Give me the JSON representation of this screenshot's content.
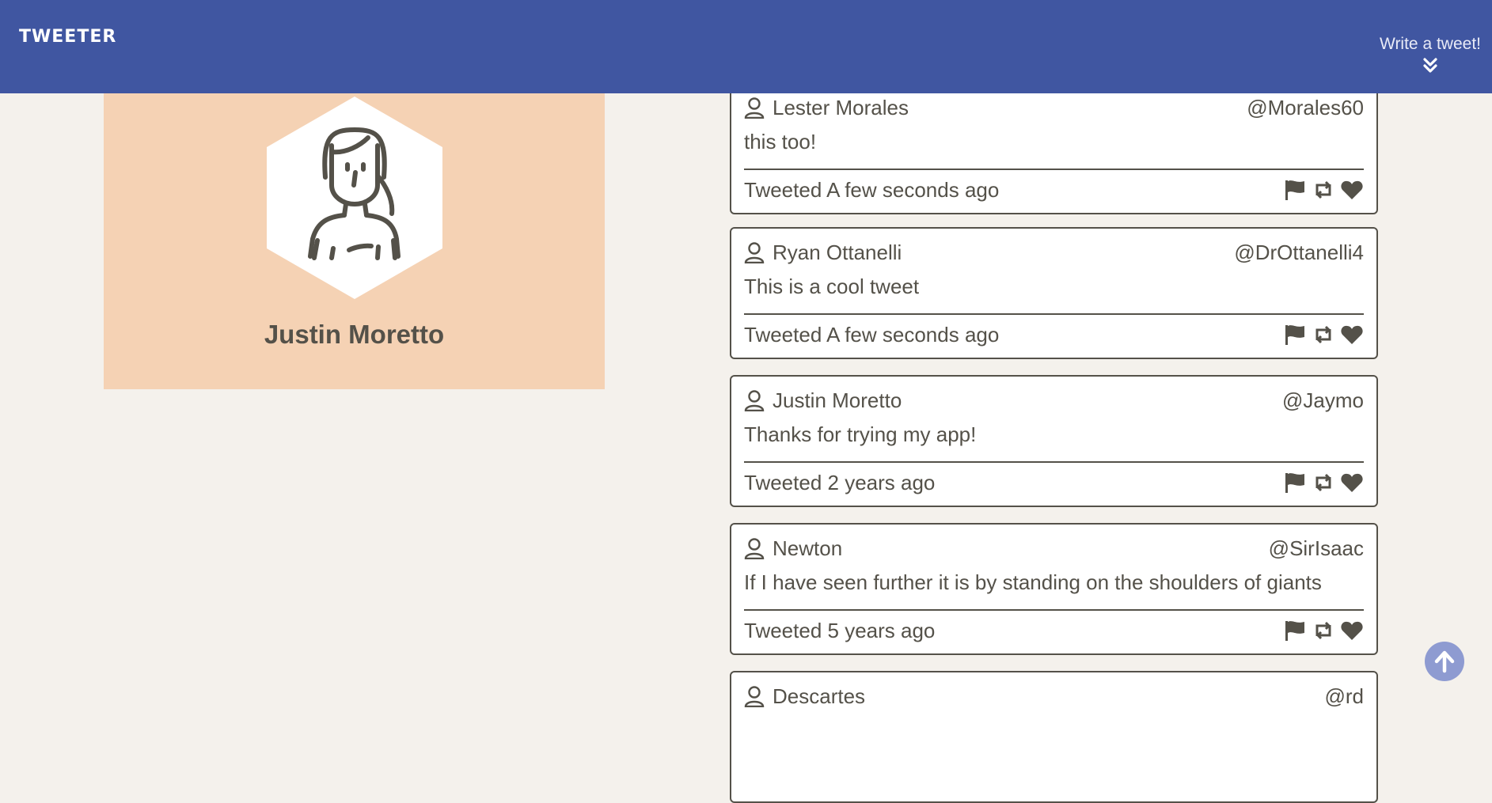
{
  "header": {
    "brand": "TWEETER",
    "write_label": "Write a tweet!",
    "write_icon": "double-chevron-down-icon",
    "bg_color": "#4056a1"
  },
  "profile": {
    "name": "Justin Moretto",
    "avatar_icon": "woman-avatar-icon",
    "card_color": "#f5d2b4"
  },
  "tweets": [
    {
      "author": "Lester Morales",
      "handle": "@Morales60",
      "text": "this too!",
      "meta": "Tweeted A few seconds ago"
    },
    {
      "author": "Ryan Ottanelli",
      "handle": "@DrOttanelli4",
      "text": "This is a cool tweet",
      "meta": "Tweeted A few seconds ago"
    },
    {
      "author": "Justin Moretto",
      "handle": "@Jaymo",
      "text": "Thanks for trying my app!",
      "meta": "Tweeted 2 years ago"
    },
    {
      "author": "Newton",
      "handle": "@SirIsaac",
      "text": "If I have seen further it is by standing on the shoulders of giants",
      "meta": "Tweeted 5 years ago"
    },
    {
      "author": "Descartes",
      "handle": "@rd",
      "text": "",
      "meta": ""
    }
  ],
  "actions": [
    "flag-icon",
    "retweet-icon",
    "heart-icon"
  ],
  "scroll_top_icon": "arrow-up-circle-icon",
  "colors": {
    "page": "#f4f1ec",
    "text": "#545149",
    "accent_button": "#8e9bd1"
  }
}
